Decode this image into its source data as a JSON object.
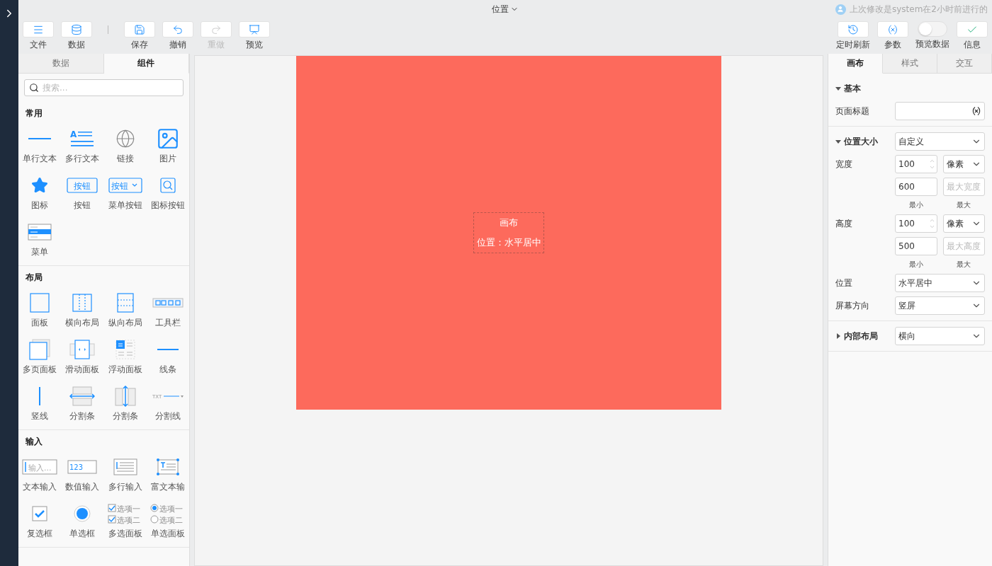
{
  "header": {
    "title": "位置",
    "last_modified": "上次修改是system在2小时前进行的"
  },
  "toolbar": {
    "left": [
      {
        "kind": "button",
        "label": "文件",
        "disabled": false
      },
      {
        "kind": "button",
        "label": "数据",
        "disabled": false
      },
      {
        "kind": "separator"
      },
      {
        "kind": "button",
        "label": "保存",
        "disabled": false
      },
      {
        "kind": "button",
        "label": "撤销",
        "disabled": false
      },
      {
        "kind": "button",
        "label": "重做",
        "disabled": true
      },
      {
        "kind": "button",
        "label": "预览",
        "disabled": false
      }
    ],
    "right": [
      {
        "kind": "button",
        "label": "定时刷新",
        "disabled": false
      },
      {
        "kind": "button",
        "label": "参数",
        "disabled": false
      },
      {
        "kind": "toggle",
        "label": "预览数据",
        "on": false
      },
      {
        "kind": "button",
        "label": "信息",
        "disabled": false
      }
    ]
  },
  "left_panel": {
    "tabs": [
      {
        "label": "数据",
        "selected": false
      },
      {
        "label": "组件",
        "selected": true
      }
    ],
    "search": {
      "placeholder": "搜索..."
    },
    "sections": [
      {
        "title": "常用",
        "items": [
          {
            "kind": "single-text",
            "label": "单行文本"
          },
          {
            "kind": "multi-text",
            "label": "多行文本",
            "icon_text": "A"
          },
          {
            "kind": "link",
            "label": "链接"
          },
          {
            "kind": "image",
            "label": "图片"
          },
          {
            "kind": "icon",
            "label": "图标"
          },
          {
            "kind": "button",
            "label": "按钮",
            "icon_text": "按钮"
          },
          {
            "kind": "menu-button",
            "label": "菜单按钮",
            "icon_text": "按钮"
          },
          {
            "kind": "icon-button",
            "label": "图标按钮"
          },
          {
            "kind": "menu",
            "label": "菜单"
          }
        ]
      },
      {
        "title": "布局",
        "items": [
          {
            "kind": "panel",
            "label": "面板"
          },
          {
            "kind": "h-layout",
            "label": "横向布局"
          },
          {
            "kind": "v-layout",
            "label": "纵向布局"
          },
          {
            "kind": "toolbar",
            "label": "工具栏"
          },
          {
            "kind": "pages",
            "label": "多页面板"
          },
          {
            "kind": "slide",
            "label": "滑动面板"
          },
          {
            "kind": "float",
            "label": "浮动面板"
          },
          {
            "kind": "line",
            "label": "线条"
          },
          {
            "kind": "v-line",
            "label": "竖线"
          },
          {
            "kind": "h-split",
            "label": "分割条"
          },
          {
            "kind": "v-split",
            "label": "分割条"
          },
          {
            "kind": "divider",
            "label": "分割线",
            "icon_text": "TXT"
          }
        ]
      },
      {
        "title": "输入",
        "items": [
          {
            "kind": "text-input",
            "label": "文本输入",
            "icon_text": "输入..."
          },
          {
            "kind": "number-input",
            "label": "数值输入",
            "icon_text": "123"
          },
          {
            "kind": "textarea",
            "label": "多行输入"
          },
          {
            "kind": "rich-text",
            "label": "富文本输"
          },
          {
            "kind": "checkbox",
            "label": "复选框"
          },
          {
            "kind": "radio",
            "label": "单选框"
          },
          {
            "kind": "check-group",
            "label": "多选面板",
            "options": [
              "选项一",
              "选项二"
            ]
          },
          {
            "kind": "radio-group",
            "label": "单选面板",
            "options": [
              "选项一",
              "选项二"
            ]
          }
        ]
      }
    ]
  },
  "canvas": {
    "page_label": "画布",
    "position_text": "位置：水平居中"
  },
  "right_panel": {
    "tabs": [
      {
        "label": "画布",
        "selected": true
      },
      {
        "label": "样式",
        "selected": false
      },
      {
        "label": "交互",
        "selected": false
      }
    ],
    "sections": [
      {
        "title": "基本",
        "expanded": true,
        "rows": [
          {
            "kind": "variable-field",
            "label": "页面标题"
          }
        ]
      },
      {
        "title": "位置大小",
        "expanded": true,
        "select": "自定义",
        "rows": [
          {
            "kind": "size",
            "label": "宽度",
            "value": "100",
            "unit": "像素",
            "min": "600",
            "max_placeholder": "最大宽度",
            "min_caption": "最小",
            "max_caption": "最大"
          },
          {
            "kind": "size",
            "label": "高度",
            "value": "100",
            "unit": "像素",
            "min": "500",
            "max_placeholder": "最大高度",
            "min_caption": "最小",
            "max_caption": "最大"
          },
          {
            "kind": "select",
            "label": "位置",
            "value": "水平居中"
          },
          {
            "kind": "select",
            "label": "屏幕方向",
            "value": "竖屏"
          }
        ]
      },
      {
        "title": "内部布局",
        "expanded": false,
        "select": "横向"
      }
    ]
  }
}
